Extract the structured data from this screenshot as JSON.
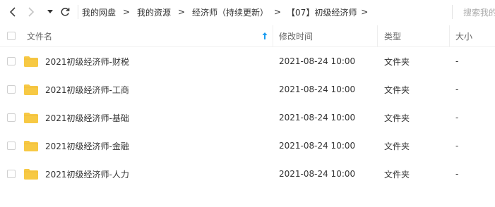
{
  "nav": {
    "back_icon": "chevron-left-icon",
    "forward_icon": "chevron-right-icon",
    "dropdown_icon": "caret-down-icon",
    "refresh_icon": "refresh-icon"
  },
  "breadcrumbs": [
    "我的网盘",
    "我的资源",
    "经济师（持续更新）",
    "【07】初级经济师"
  ],
  "breadcrumb_separator": ">",
  "search": {
    "placeholder": "搜索我的"
  },
  "columns": {
    "name": "文件名",
    "modified": "修改时间",
    "type": "类型",
    "size": "大小"
  },
  "sort_icon": "arrow-up-icon",
  "files": [
    {
      "name": "2021初级经济师-财税",
      "modified": "2021-08-24 10:00",
      "type": "文件夹",
      "size": "-"
    },
    {
      "name": "2021初级经济师-工商",
      "modified": "2021-08-24 10:00",
      "type": "文件夹",
      "size": "-"
    },
    {
      "name": "2021初级经济师-基础",
      "modified": "2021-08-24 10:00",
      "type": "文件夹",
      "size": "-"
    },
    {
      "name": "2021初级经济师-金融",
      "modified": "2021-08-24 10:00",
      "type": "文件夹",
      "size": "-"
    },
    {
      "name": "2021初级经济师-人力",
      "modified": "2021-08-24 10:00",
      "type": "文件夹",
      "size": "-"
    }
  ],
  "colors": {
    "folder": "#f7c944",
    "folder_tab": "#f0b83a",
    "sort_arrow": "#1a9cf0"
  }
}
